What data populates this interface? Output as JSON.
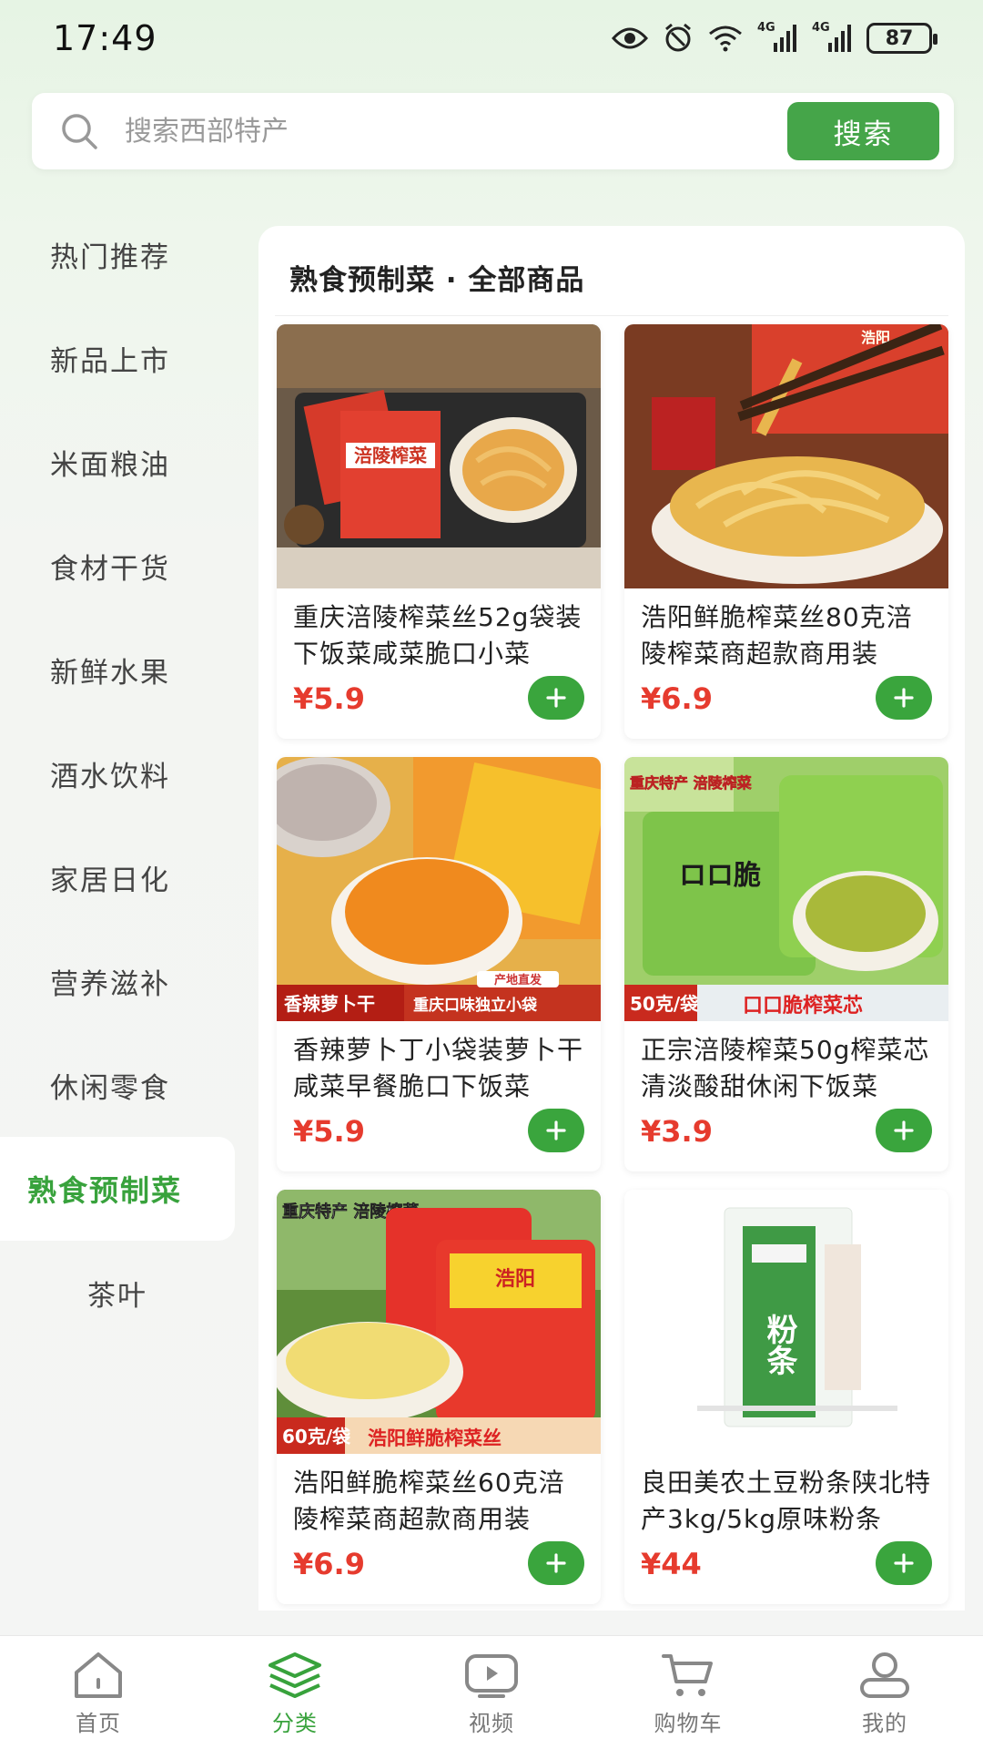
{
  "status_bar": {
    "time": "17:49",
    "network_1": "4G",
    "network_2": "4G",
    "battery": "87"
  },
  "search": {
    "placeholder": "搜索西部特产",
    "button_label": "搜索"
  },
  "sidebar": {
    "items": [
      {
        "label": "热门推荐"
      },
      {
        "label": "新品上市"
      },
      {
        "label": "米面粮油"
      },
      {
        "label": "食材干货"
      },
      {
        "label": "新鲜水果"
      },
      {
        "label": "酒水饮料"
      },
      {
        "label": "家居日化"
      },
      {
        "label": "营养滋补"
      },
      {
        "label": "休闲零食"
      },
      {
        "label": "熟食预制菜",
        "active": true
      },
      {
        "label": "茶叶"
      }
    ]
  },
  "panel": {
    "title": "熟食预制菜 · 全部商品"
  },
  "products": [
    {
      "name": "重庆涪陵榨菜丝52g袋装下饭菜咸菜脆口小菜",
      "price": "¥5.9",
      "img_text": "涪陵榨菜"
    },
    {
      "name": "浩阳鲜脆榨菜丝80克涪陵榨菜商超款商用装",
      "price": "¥6.9",
      "img_text": "浩阳"
    },
    {
      "name": "香辣萝卜丁小袋装萝卜干咸菜早餐脆口下饭菜",
      "price": "¥5.9",
      "img_text": "香辣萝卜干",
      "img_text_2": "重庆口味独立小袋",
      "img_text_3": "产地直发"
    },
    {
      "name": "正宗涪陵榨菜50g榨菜芯清淡酸甜休闲下饭菜",
      "price": "¥3.9",
      "img_text": "50克/袋",
      "img_text_2": "口口脆榨菜芯",
      "img_text_3": "重庆特产 涪陵榨菜"
    },
    {
      "name": "浩阳鲜脆榨菜丝60克涪陵榨菜商超款商用装",
      "price": "¥6.9",
      "img_text": "60克/袋",
      "img_text_2": "浩阳鲜脆榨菜丝",
      "img_text_3": "重庆特产 涪陵榨菜"
    },
    {
      "name": "良田美农土豆粉条陕北特产3kg/5kg原味粉条",
      "price": "¥44",
      "img_text": "粉条"
    }
  ],
  "bottom_nav": {
    "items": [
      {
        "label": "首页"
      },
      {
        "label": "分类",
        "active": true
      },
      {
        "label": "视频"
      },
      {
        "label": "购物车"
      },
      {
        "label": "我的"
      }
    ]
  },
  "colors": {
    "accent": "#3aa53d",
    "price": "#e63b2e",
    "active_text": "#38a23c"
  }
}
